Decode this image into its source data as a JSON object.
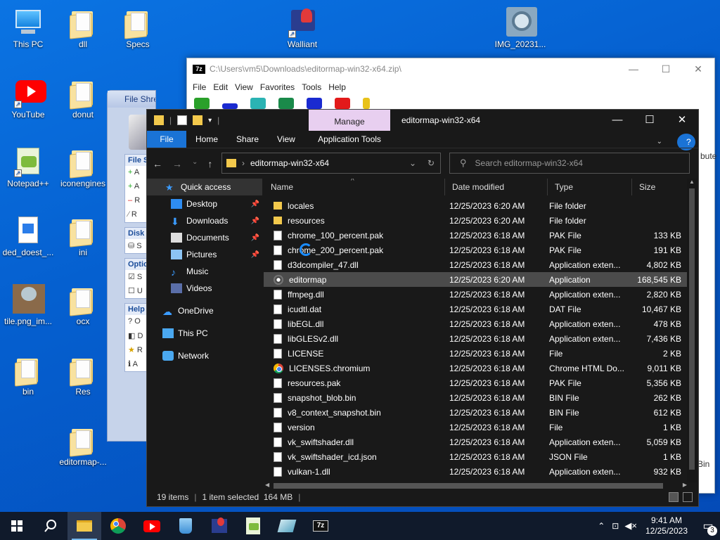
{
  "desktop": {
    "icons": [
      {
        "label": "This PC"
      },
      {
        "label": "dll"
      },
      {
        "label": "Specs"
      },
      {
        "label": "Walliant"
      },
      {
        "label": "IMG_20231..."
      },
      {
        "label": "YouTube"
      },
      {
        "label": "donut"
      },
      {
        "label": "Notepad++"
      },
      {
        "label": "iconengines"
      },
      {
        "label": "ded_doest_..."
      },
      {
        "label": "ini"
      },
      {
        "label": "tile.png_im..."
      },
      {
        "label": "ocx"
      },
      {
        "label": "bin"
      },
      {
        "label": "Res"
      },
      {
        "label": "editormap-..."
      }
    ]
  },
  "zip_window": {
    "logo": "7z",
    "title": "C:\\Users\\vm5\\Downloads\\editormap-win32-x64.zip\\",
    "menu": [
      "File",
      "Edit",
      "View",
      "Favorites",
      "Tools",
      "Help"
    ],
    "minimize": "—",
    "maximize": "☐",
    "close": "✕",
    "side_text_1": "bute",
    "side_text_2": "Bin"
  },
  "shredder": {
    "title": "File Shredder",
    "sections": [
      {
        "header": "File S",
        "items": [
          "A",
          "A",
          "R",
          "R"
        ]
      },
      {
        "header": "Disk",
        "items": [
          "S"
        ]
      },
      {
        "header": "Optio",
        "items": [
          "S",
          "U"
        ]
      },
      {
        "header": "Help",
        "items": [
          "O",
          "D",
          "R",
          "A"
        ]
      }
    ]
  },
  "explorer": {
    "manage_tab": "Manage",
    "window_title": "editormap-win32-x64",
    "ribbon": {
      "file": "File",
      "home": "Home",
      "share": "Share",
      "view": "View",
      "app_tools": "Application Tools"
    },
    "address": "editormap-win32-x64",
    "search_placeholder": "Search editormap-win32-x64",
    "nav": [
      {
        "label": "Quick access",
        "pinned": false
      },
      {
        "label": "Desktop",
        "pinned": true
      },
      {
        "label": "Downloads",
        "pinned": true
      },
      {
        "label": "Documents",
        "pinned": true
      },
      {
        "label": "Pictures",
        "pinned": true
      },
      {
        "label": "Music",
        "pinned": false
      },
      {
        "label": "Videos",
        "pinned": false
      },
      {
        "label": "OneDrive",
        "pinned": false
      },
      {
        "label": "This PC",
        "pinned": false
      },
      {
        "label": "Network",
        "pinned": false
      }
    ],
    "columns": [
      "Name",
      "Date modified",
      "Type",
      "Size"
    ],
    "files": [
      {
        "name": "locales",
        "date": "12/25/2023 6:20 AM",
        "type": "File folder",
        "size": "",
        "icon": "folder"
      },
      {
        "name": "resources",
        "date": "12/25/2023 6:20 AM",
        "type": "File folder",
        "size": "",
        "icon": "folder"
      },
      {
        "name": "chrome_100_percent.pak",
        "date": "12/25/2023 6:18 AM",
        "type": "PAK File",
        "size": "133 KB",
        "icon": "doc"
      },
      {
        "name": "chrome_200_percent.pak",
        "date": "12/25/2023 6:18 AM",
        "type": "PAK File",
        "size": "191 KB",
        "icon": "doc"
      },
      {
        "name": "d3dcompiler_47.dll",
        "date": "12/25/2023 6:18 AM",
        "type": "Application exten...",
        "size": "4,802 KB",
        "icon": "cog"
      },
      {
        "name": "editormap",
        "date": "12/25/2023 6:20 AM",
        "type": "Application",
        "size": "168,545 KB",
        "icon": "editormap"
      },
      {
        "name": "ffmpeg.dll",
        "date": "12/25/2023 6:18 AM",
        "type": "Application exten...",
        "size": "2,820 KB",
        "icon": "cog"
      },
      {
        "name": "icudtl.dat",
        "date": "12/25/2023 6:18 AM",
        "type": "DAT File",
        "size": "10,467 KB",
        "icon": "doc"
      },
      {
        "name": "libEGL.dll",
        "date": "12/25/2023 6:18 AM",
        "type": "Application exten...",
        "size": "478 KB",
        "icon": "cog"
      },
      {
        "name": "libGLESv2.dll",
        "date": "12/25/2023 6:18 AM",
        "type": "Application exten...",
        "size": "7,436 KB",
        "icon": "cog"
      },
      {
        "name": "LICENSE",
        "date": "12/25/2023 6:18 AM",
        "type": "File",
        "size": "2 KB",
        "icon": "doc"
      },
      {
        "name": "LICENSES.chromium",
        "date": "12/25/2023 6:18 AM",
        "type": "Chrome HTML Do...",
        "size": "9,011 KB",
        "icon": "chrome"
      },
      {
        "name": "resources.pak",
        "date": "12/25/2023 6:18 AM",
        "type": "PAK File",
        "size": "5,356 KB",
        "icon": "doc"
      },
      {
        "name": "snapshot_blob.bin",
        "date": "12/25/2023 6:18 AM",
        "type": "BIN File",
        "size": "262 KB",
        "icon": "doc"
      },
      {
        "name": "v8_context_snapshot.bin",
        "date": "12/25/2023 6:18 AM",
        "type": "BIN File",
        "size": "612 KB",
        "icon": "doc"
      },
      {
        "name": "version",
        "date": "12/25/2023 6:18 AM",
        "type": "File",
        "size": "1 KB",
        "icon": "doc"
      },
      {
        "name": "vk_swiftshader.dll",
        "date": "12/25/2023 6:18 AM",
        "type": "Application exten...",
        "size": "5,059 KB",
        "icon": "cog"
      },
      {
        "name": "vk_swiftshader_icd.json",
        "date": "12/25/2023 6:18 AM",
        "type": "JSON File",
        "size": "1 KB",
        "icon": "doc"
      },
      {
        "name": "vulkan-1.dll",
        "date": "12/25/2023 6:18 AM",
        "type": "Application exten...",
        "size": "932 KB",
        "icon": "cog"
      }
    ],
    "selected_index": 5,
    "status": {
      "count": "19 items",
      "selection": "1 item selected  164 MB"
    }
  },
  "taskbar": {
    "apps": [
      "start-button",
      "search",
      "file-explorer",
      "chrome",
      "youtube",
      "recycle",
      "walliant",
      "notepad-plus-plus",
      "app-icon",
      "7zip"
    ],
    "active_app": "file-explorer",
    "time": "9:41 AM",
    "date": "12/25/2023",
    "notifications": "3"
  },
  "colors": {
    "desktop": "#0a64d6",
    "explorer_bg": "#191919",
    "accent": "#1a73d6",
    "manage_tab": "#e8cff0",
    "taskbar": "#101a2b"
  }
}
